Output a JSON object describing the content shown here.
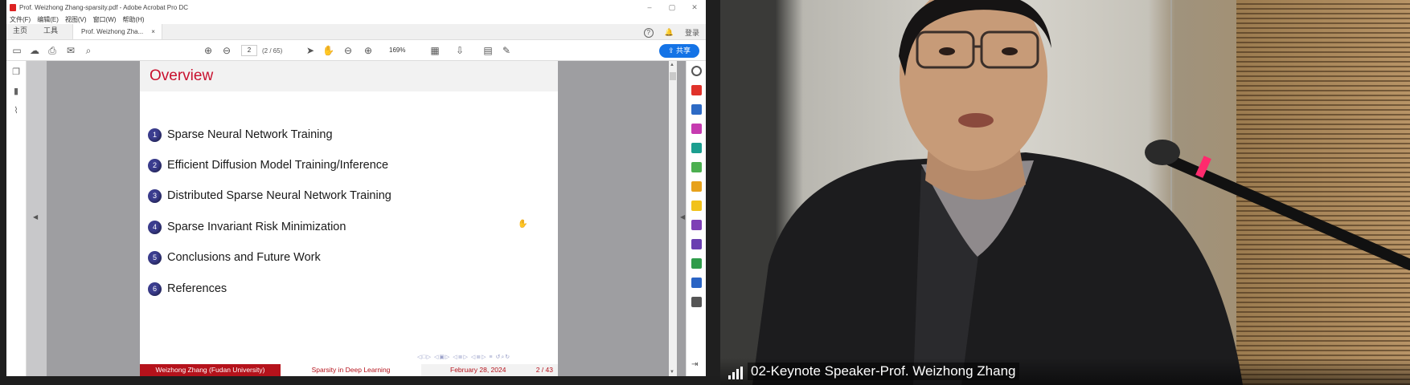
{
  "acrobat": {
    "title": "Prof. Weizhong Zhang-sparsity.pdf - Adobe Acrobat Pro DC",
    "menu": [
      "文件(F)",
      "编辑(E)",
      "视图(V)",
      "窗口(W)",
      "帮助(H)"
    ],
    "home_tab": "主页",
    "tools_tab": "工具",
    "doc_tab": "Prof. Weizhong Zha...",
    "doc_tab_close": "×",
    "login": "登录",
    "help": "?",
    "page_input": "2",
    "page_count": "(2 / 65)",
    "zoom": "169%",
    "share": "共享"
  },
  "slide": {
    "title": "Overview",
    "items": [
      {
        "num": "1",
        "text": "Sparse Neural Network Training"
      },
      {
        "num": "2",
        "text": "Efficient Diffusion Model Training/Inference"
      },
      {
        "num": "3",
        "text": "Distributed Sparse Neural Network Training"
      },
      {
        "num": "4",
        "text": "Sparse Invariant Risk Minimization"
      },
      {
        "num": "5",
        "text": "Conclusions and Future Work"
      },
      {
        "num": "6",
        "text": "References"
      }
    ],
    "footer": {
      "author": "Weizhong Zhang  (Fudan University)",
      "talk": "Sparsity in Deep Learning",
      "date": "February 28, 2024",
      "page": "2 / 43"
    }
  },
  "video": {
    "participant_label": "02-Keynote Speaker-Prof. Weizhong Zhang"
  },
  "colors": {
    "slide_red": "#c8102e",
    "footer_red": "#b5121b",
    "bullet_blue": "#3b3d8f",
    "share_blue": "#1473e6"
  }
}
